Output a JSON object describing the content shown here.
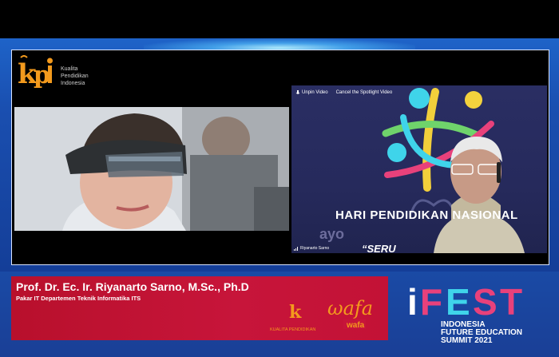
{
  "topbar": {
    "label": ""
  },
  "logo_kpi": {
    "initials": "kpi",
    "line1": "Kualita",
    "line2": "Pendidikan",
    "line3": "Indonesia"
  },
  "zoom_controls": {
    "unpin": "Unpin Video",
    "cancel_spotlight": "Cancel the Spotlight Video"
  },
  "slide": {
    "headline": "HARI PENDIDIKAN NASIONAL",
    "ayo": "ayo",
    "serum": "“SERU"
  },
  "participant_name": "Riyanarto Sarno",
  "caption": {
    "name": "Prof. Dr. Ec. Ir. Riyanarto Sarno, M.Sc., Ph.D",
    "role": "Pakar IT Departemen Teknik Informatika ITS"
  },
  "sponsors": {
    "kpi": "KUALITA PENDIDIKAN",
    "wafa": "wafa"
  },
  "event": {
    "brand": "iFEST",
    "line1": "INDONESIA",
    "line2": "FUTURE EDUCATION",
    "line3": "SUMMIT 2021"
  },
  "colors": {
    "brand_orange": "#f39a1d",
    "caption_red": "#c7153a",
    "frame_blue": "#1e63c8",
    "ifest_pink": "#e8417b",
    "ifest_cyan": "#3fd4ea"
  }
}
